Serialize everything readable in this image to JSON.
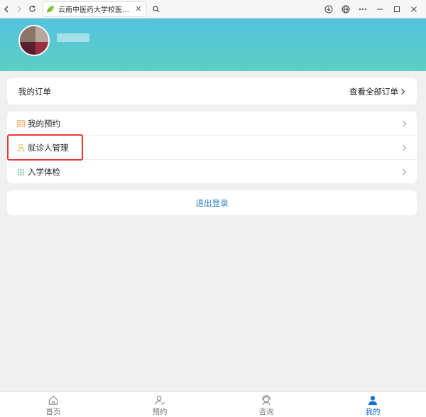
{
  "browser": {
    "tab_title": "云南中医药大学校医院--个人中心"
  },
  "orders": {
    "title": "我的订单",
    "view_all": "查看全部订单"
  },
  "menu": {
    "items": [
      {
        "label": "我的预约",
        "icon": "calendar-icon"
      },
      {
        "label": "就诊人管理",
        "icon": "patient-icon"
      },
      {
        "label": "入学体检",
        "icon": "grid-icon"
      }
    ]
  },
  "logout": {
    "label": "退出登录"
  },
  "bottom_nav": {
    "items": [
      {
        "label": "首页",
        "icon": "home-icon"
      },
      {
        "label": "预约",
        "icon": "appointment-icon"
      },
      {
        "label": "咨询",
        "icon": "consult-icon"
      },
      {
        "label": "我的",
        "icon": "user-icon"
      }
    ],
    "active_index": 3
  },
  "colors": {
    "header_gradient_top": "#55c2df",
    "header_gradient_bottom": "#5ccfc3",
    "active_tab": "#1a6fd0",
    "logout_text": "#2a7fc1",
    "highlight": "#e53935"
  }
}
